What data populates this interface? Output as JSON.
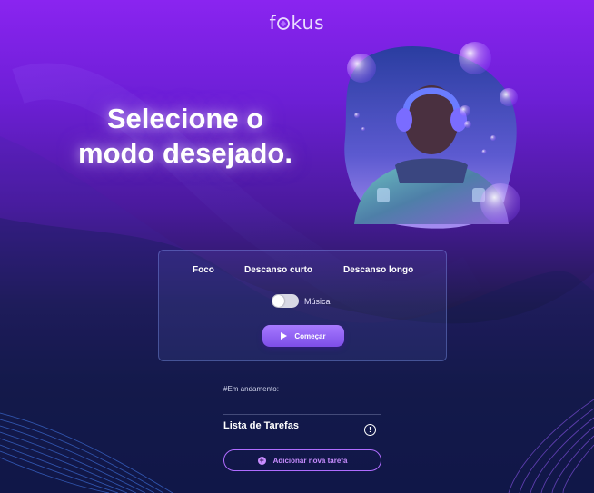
{
  "app": {
    "logo_text_prefix": "f",
    "logo_text_suffix": "kus"
  },
  "hero": {
    "headline_line1": "Selecione o",
    "headline_line2": "modo desejado."
  },
  "timer_card": {
    "tabs": [
      {
        "label": "Foco"
      },
      {
        "label": "Descanso curto"
      },
      {
        "label": "Descanso longo"
      }
    ],
    "music_toggle": {
      "label": "Música",
      "state": "off"
    },
    "start_button": {
      "label": "Começar",
      "icon": "play-icon"
    }
  },
  "tasks": {
    "in_progress_label": "#Em andamento:",
    "title": "Lista de Tarefas",
    "info_icon": "info-icon",
    "add_button": {
      "label": "Adicionar nova tarefa",
      "icon": "plus-circle-icon"
    }
  },
  "colors": {
    "accent": "#b06cff",
    "button_gradient_top": "#a77aff",
    "button_gradient_bottom": "#7d4ee8",
    "bg_top": "#8a24f0",
    "bg_bottom": "#06112a"
  }
}
